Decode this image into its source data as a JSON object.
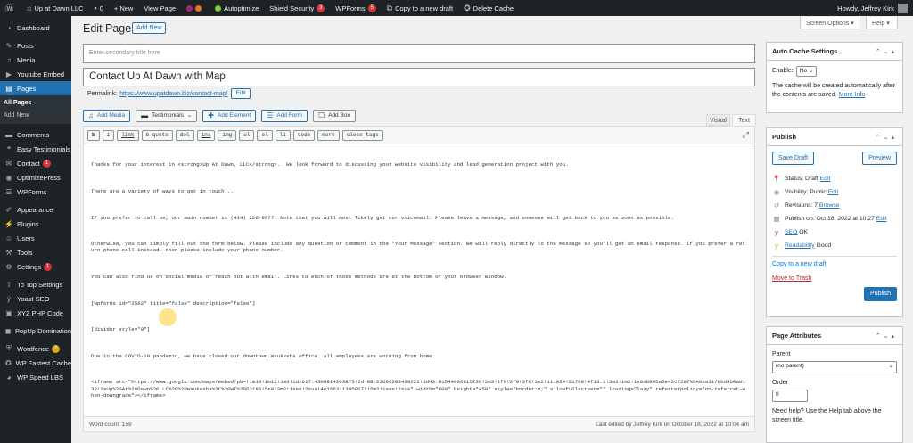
{
  "admin_bar": {
    "site_name": "Up at Dawn LLC",
    "comments_count": "0",
    "new_label": "+ New",
    "view_page": "View Page",
    "autoptimize": "Autoptimize",
    "shield": "Shield Security",
    "shield_count": "3",
    "wpforms": "WPForms",
    "wpforms_count": "5",
    "copy_draft": "Copy to a new draft",
    "delete_cache": "Delete Cache",
    "howdy": "Howdy, Jeffrey Kirk"
  },
  "screen_meta": {
    "screen_options": "Screen Options ▾",
    "help": "Help ▾"
  },
  "sidebar": {
    "items": [
      {
        "label": "Dashboard",
        "icon": "dashboard-icon"
      },
      {
        "label": "Posts",
        "icon": "pin-icon"
      },
      {
        "label": "Media",
        "icon": "media-icon"
      },
      {
        "label": "Youtube Embed",
        "icon": "video-icon"
      },
      {
        "label": "Pages",
        "icon": "page-icon"
      },
      {
        "label": "Comments",
        "icon": "comment-icon"
      },
      {
        "label": "Easy Testimonials",
        "icon": "quote-icon"
      },
      {
        "label": "Contact",
        "icon": "mail-icon",
        "badge": "1"
      },
      {
        "label": "OptimizePress",
        "icon": "op-icon"
      },
      {
        "label": "WPForms",
        "icon": "form-icon"
      },
      {
        "label": "Appearance",
        "icon": "brush-icon"
      },
      {
        "label": "Plugins",
        "icon": "plugin-icon"
      },
      {
        "label": "Users",
        "icon": "user-icon"
      },
      {
        "label": "Tools",
        "icon": "wrench-icon"
      },
      {
        "label": "Settings",
        "icon": "settings-icon",
        "badge": "1"
      },
      {
        "label": "To Top Settings",
        "icon": "arrow-up-icon"
      },
      {
        "label": "Yoast SEO",
        "icon": "yoast-icon"
      },
      {
        "label": "XYZ PHP Code",
        "icon": "code-icon"
      },
      {
        "label": "PopUp Domination",
        "icon": "popup-icon"
      },
      {
        "label": "Wordfence",
        "icon": "shield-icon",
        "badge": "2"
      },
      {
        "label": "WP Fastest Cache",
        "icon": "bolt-icon"
      },
      {
        "label": "WP Speed LBS",
        "icon": "speed-icon"
      }
    ],
    "pages_sub": [
      "All Pages",
      "Add New"
    ]
  },
  "main": {
    "heading": "Edit Page",
    "add_new": "Add New",
    "secondary_title_placeholder": "Enter secondary title here",
    "title": "Contact Up At Dawn with Map",
    "permalink_label": "Permalink:",
    "permalink_url": "https://www.upatdawn.biz/contact-map/",
    "edit_label": "Edit",
    "media_buttons": [
      "Add Media",
      "Testimonials",
      "Add Element",
      "Add Form",
      "Add Box"
    ],
    "tabs": [
      "Visual",
      "Text"
    ],
    "quicktags": [
      "b",
      "i",
      "link",
      "b-quote",
      "del",
      "ins",
      "img",
      "ul",
      "ol",
      "li",
      "code",
      "more",
      "close tags"
    ],
    "content": [
      "Thanks for your interest in <strong>Up At Dawn, LLC</strong>.  We look forward to discussing your website visibility and lead generation project with you.",
      "There are a variety of ways to get in touch...",
      "If you prefer to call us, our main number is (414) 226-9577. Note that you will most likely get our voicemail. Please leave a message, and someone will get back to you as soon as possible.",
      "Otherwise, you can simply fill out the form below. Please include any question or comment in the \"Your Message\" section. We will reply directly to the message so you'll get an email response. If you prefer a return phone call instead, then please include your phone number.",
      "You can also find us on social media or reach out with email. Links to each of those methods are at the bottom of your browser window.",
      "[wpforms id=\"2562\" title=\"false\" description=\"false\"]",
      "[divider style=\"9\"]",
      "Due to the COVID-19 pandemic, we have closed our downtown Waukesha office. All employees are working from home.",
      "<iframe src=\"https://www.google.com/maps/embed?pb=!1m18!1m12!1m3!1d2917.4309814203875!2d-88.23660208439222!3d43.01544002615726!2m3!1f0!2f0!3f0!3m2!1i1024!2i768!4f13.1!3m3!1m2!1s0x8805a5e42cf297%3A0xa11/8bd8b0a0133!2sUp%20At%20Dawn%20LLC%2C%20Waukesha%2C%20WI%2053186!5e0!3m2!1sen!2sus!4v1663113958172!5m2!1sen!2sus\" width=\"600\" height=\"450\" style=\"border:0;\" allowfullscreen=\"\" loading=\"lazy\" referrerpolicy=\"no-referrer-when-downgrade\"></iframe>"
    ],
    "word_count": "Word count: 159",
    "last_edited": "Last edited by Jeffrey Kirk on October 18, 2022 at 10:04 am"
  },
  "auto_cache": {
    "title": "Auto Cache Settings",
    "enable_label": "Enable:",
    "enable_value": "No",
    "description": "The cache will be created automatically after the contents are saved.",
    "more_info": "More Info"
  },
  "publish": {
    "title": "Publish",
    "save_draft": "Save Draft",
    "preview": "Preview",
    "status_label": "Status: Draft",
    "status_edit": "Edit",
    "visibility_label": "Visibility: Public",
    "visibility_edit": "Edit",
    "revisions_label": "Revisions: 7",
    "revisions_browse": "Browse",
    "publish_label": "Publish on: Oct 18, 2022 at 10:27",
    "publish_edit": "Edit",
    "seo_label": "SEO",
    "seo_value": "OK",
    "readability_label": "Readability",
    "readability_value": "Good",
    "copy_draft": "Copy to a new draft",
    "trash": "Move to Trash",
    "publish_button": "Publish"
  },
  "attributes": {
    "title": "Page Attributes",
    "parent_label": "Parent",
    "parent_value": "(no parent)",
    "order_label": "Order",
    "order_value": "0",
    "help_text": "Need help? Use the Help tab above the screen title."
  },
  "colors": {
    "accent": "#2271b1",
    "admin_dark": "#1d2327",
    "badge": "#d63638",
    "yoast_ok": "#7ad03a"
  }
}
